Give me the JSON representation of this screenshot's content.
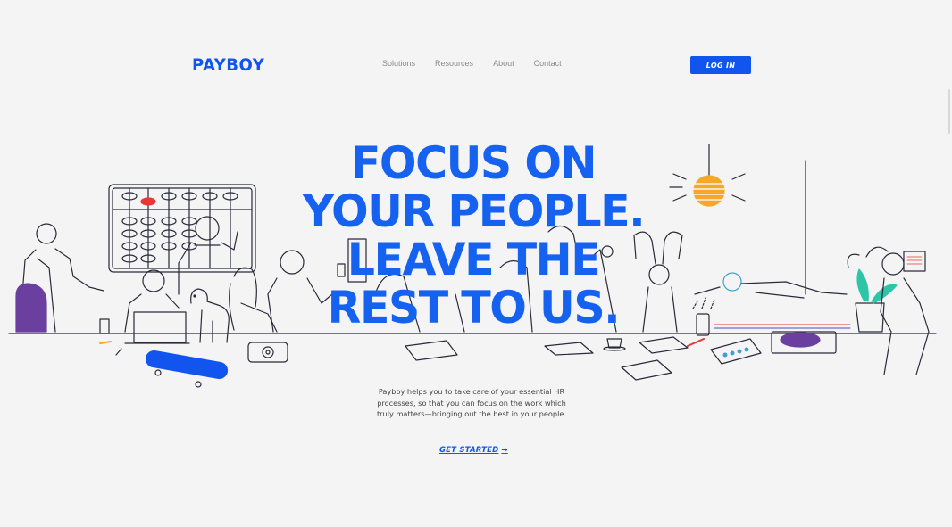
{
  "brand": {
    "logo": "PAYBOY",
    "accent": "#1155ee",
    "headline_color": "#1562f0"
  },
  "nav": {
    "items": [
      "Solutions",
      "Resources",
      "About",
      "Contact"
    ],
    "login_label": "LOG IN"
  },
  "hero": {
    "headline_lines": [
      "FOCUS ON",
      "YOUR PEOPLE.",
      "LEAVE THE",
      "REST TO US."
    ],
    "description": "Payboy helps you to take care of your essential HR processes, so that you can focus on the work which truly matters—bringing out the best in your people.",
    "cta_label": "GET STARTED",
    "cta_arrow": "→"
  },
  "illustration": {
    "icons": [
      "abacus-icon",
      "lamp-icon",
      "skateboard-icon",
      "turntable-icon",
      "plant-icon",
      "laptop-icon",
      "dog-icon",
      "coffee-cup-icon"
    ]
  }
}
